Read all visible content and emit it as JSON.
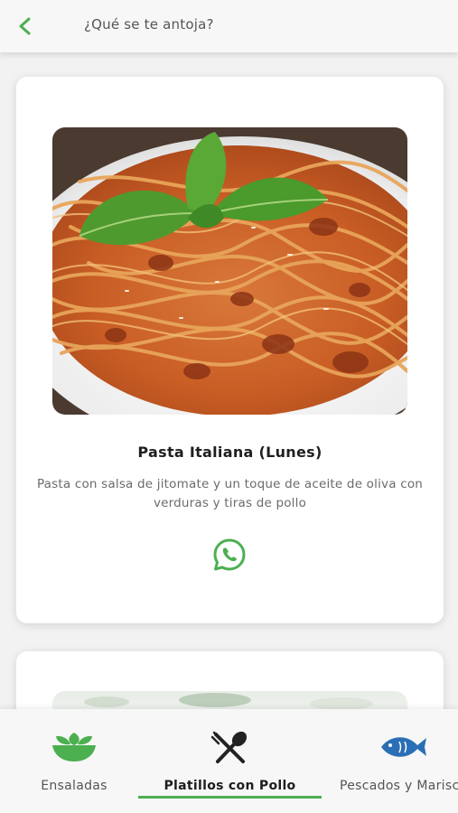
{
  "header": {
    "title": "¿Qué se te antoja?",
    "back_icon": "chevron-left-icon"
  },
  "colors": {
    "accent": "#4caf50",
    "whatsapp": "#4caf50",
    "fish": "#2a6fb5",
    "cutlery": "#222222"
  },
  "dishes": [
    {
      "title": "Pasta Italiana (Lunes)",
      "description": "Pasta con salsa de jitomate y un toque de aceite de oliva con verduras y tiras de pollo",
      "image": "spaghetti-bolognese-photo",
      "action_icon": "whatsapp-icon"
    },
    {
      "image": "salad-photo"
    }
  ],
  "nav": {
    "items": [
      {
        "label": "Ensaladas",
        "icon": "leaf-bowl-icon",
        "active": false
      },
      {
        "label": "Platillos con Pollo",
        "icon": "fork-spoon-icon",
        "active": true
      },
      {
        "label": "Pescados y Mariscos",
        "icon": "fish-icon",
        "active": false
      }
    ]
  }
}
